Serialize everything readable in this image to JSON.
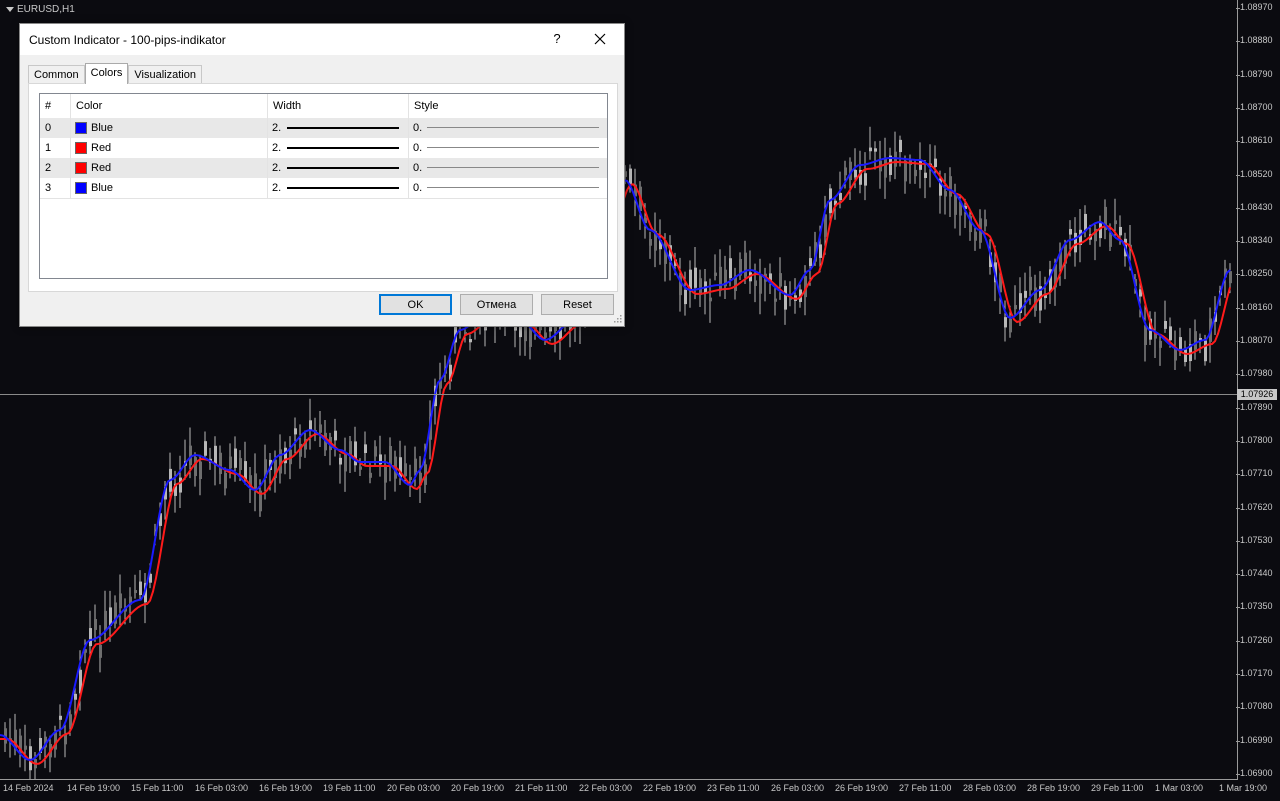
{
  "chart": {
    "symbol": "EURUSD,H1",
    "current_price": "1.07926",
    "price_ticks": [
      "1.08970",
      "1.08880",
      "1.08790",
      "1.08700",
      "1.08610",
      "1.08520",
      "1.08430",
      "1.08340",
      "1.08250",
      "1.08160",
      "1.08070",
      "1.07980",
      "1.07890",
      "1.07800",
      "1.07710",
      "1.07620",
      "1.07530",
      "1.07440",
      "1.07350",
      "1.07260",
      "1.07170",
      "1.07080",
      "1.06990",
      "1.06900"
    ],
    "time_ticks": [
      "14 Feb 2024",
      "14 Feb 19:00",
      "15 Feb 11:00",
      "16 Feb 03:00",
      "16 Feb 19:00",
      "19 Feb 11:00",
      "20 Feb 03:00",
      "20 Feb 19:00",
      "21 Feb 11:00",
      "22 Feb 03:00",
      "22 Feb 19:00",
      "23 Feb 11:00",
      "26 Feb 03:00",
      "26 Feb 19:00",
      "27 Feb 11:00",
      "28 Feb 03:00",
      "28 Feb 19:00",
      "29 Feb 11:00",
      "1 Mar 03:00",
      "1 Mar 19:00"
    ],
    "colors": {
      "background": "#0b0b10",
      "candle": "#b8b8b8",
      "line_blue": "#1a1aff",
      "line_red": "#ff1a1a",
      "axis": "#9a9a9a"
    }
  },
  "dialog": {
    "title": "Custom Indicator - 100-pips-indikator",
    "help_label": "?",
    "tabs": [
      "Common",
      "Colors",
      "Visualization"
    ],
    "active_tab": 1,
    "columns": [
      "#",
      "Color",
      "Width",
      "Style"
    ],
    "rows": [
      {
        "index": "0",
        "color_name": "Blue",
        "color_hex": "#0000ff",
        "width": "2.",
        "style": "0."
      },
      {
        "index": "1",
        "color_name": "Red",
        "color_hex": "#ff0000",
        "width": "2.",
        "style": "0."
      },
      {
        "index": "2",
        "color_name": "Red",
        "color_hex": "#ff0000",
        "width": "2.",
        "style": "0."
      },
      {
        "index": "3",
        "color_name": "Blue",
        "color_hex": "#0000ff",
        "width": "2.",
        "style": "0."
      }
    ],
    "buttons": {
      "ok": "OK",
      "cancel": "Отмена",
      "reset": "Reset"
    }
  }
}
